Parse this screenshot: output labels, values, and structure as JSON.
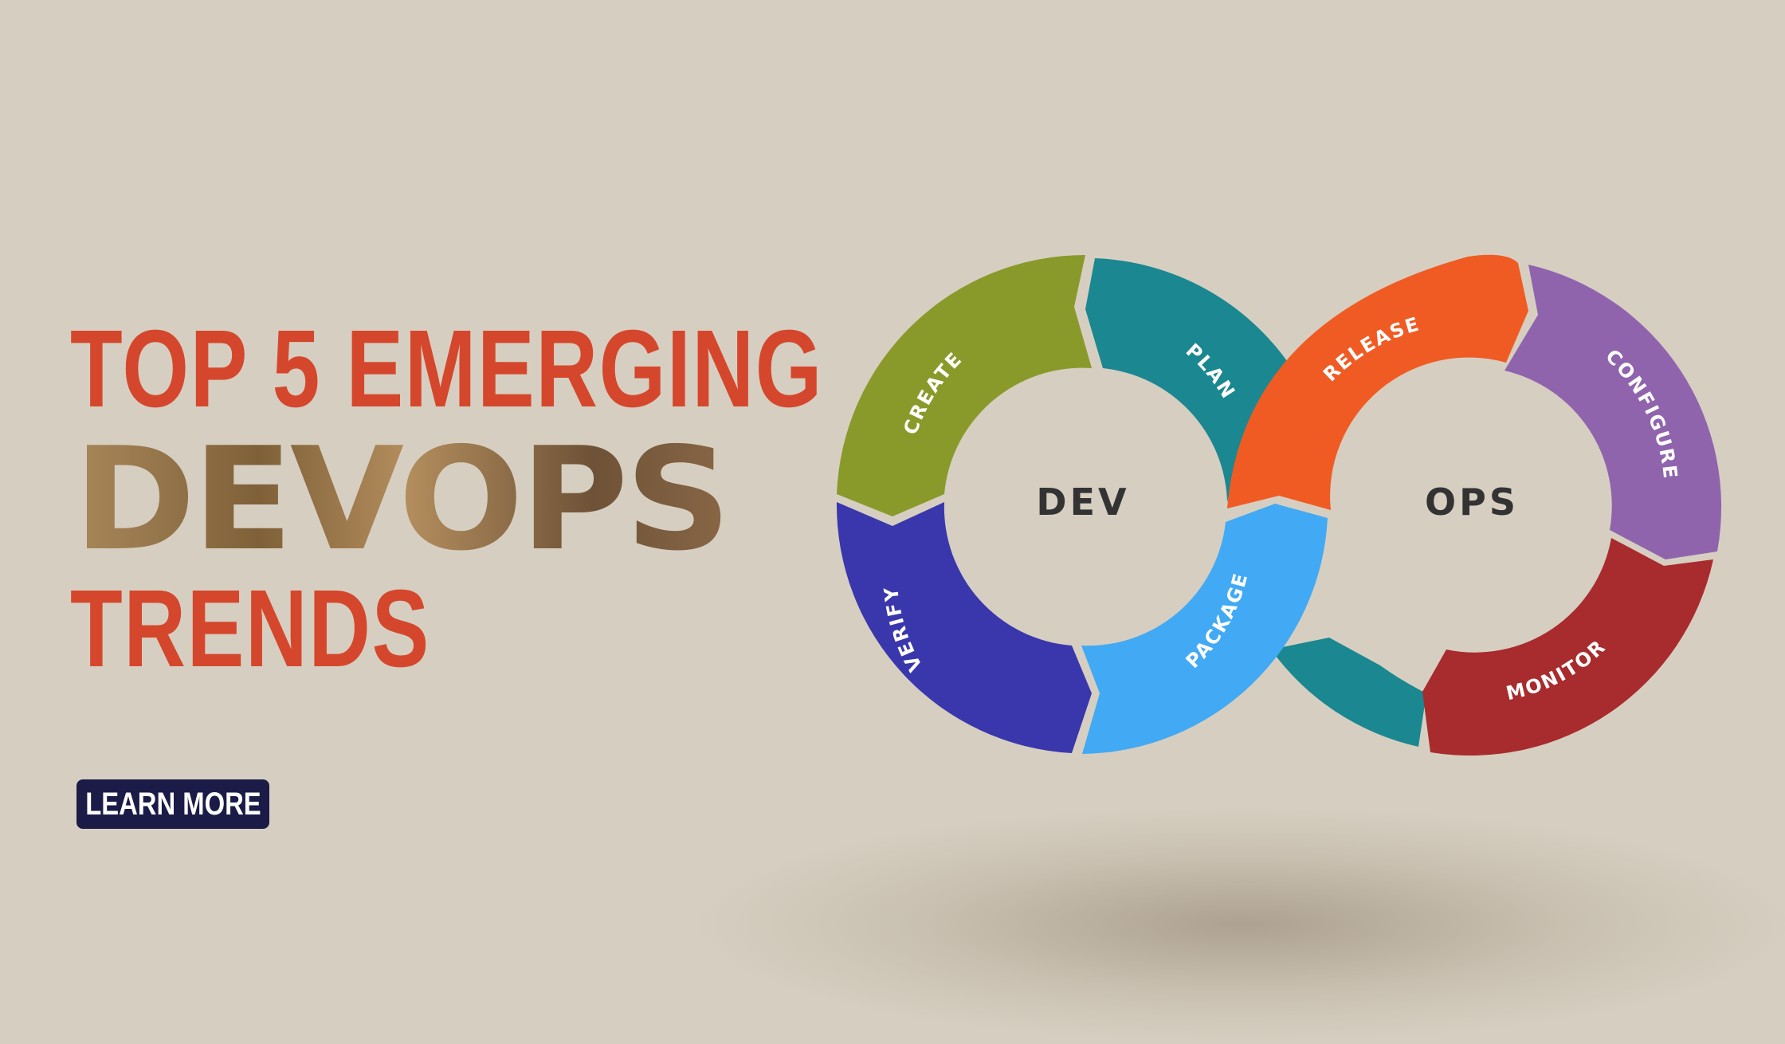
{
  "headline": {
    "line1": "TOP 5 EMERGING",
    "line2": "DEVOPS",
    "line3": "TRENDS"
  },
  "cta": {
    "label": "LEARN MORE"
  },
  "diagram": {
    "left_center": "DEV",
    "right_center": "OPS",
    "segments": [
      {
        "key": "create",
        "label": "CREATE",
        "color": "#8a9a2a"
      },
      {
        "key": "plan",
        "label": "PLAN",
        "color": "#1b8790"
      },
      {
        "key": "verify",
        "label": "VERIFY",
        "color": "#3a37ad"
      },
      {
        "key": "package",
        "label": "PACKAGE",
        "color": "#42a9f4"
      },
      {
        "key": "release",
        "label": "RELEASE",
        "color": "#f05b24"
      },
      {
        "key": "configure",
        "label": "CONFIGURE",
        "color": "#9064ad"
      },
      {
        "key": "monitor",
        "label": "MONITOR",
        "color": "#a82b2d"
      },
      {
        "key": "crossover",
        "label": "",
        "color": "#1b8790"
      }
    ]
  },
  "colors": {
    "background": "#d6cfc1",
    "headline": "#d5472c",
    "button": "#1b1b48"
  }
}
